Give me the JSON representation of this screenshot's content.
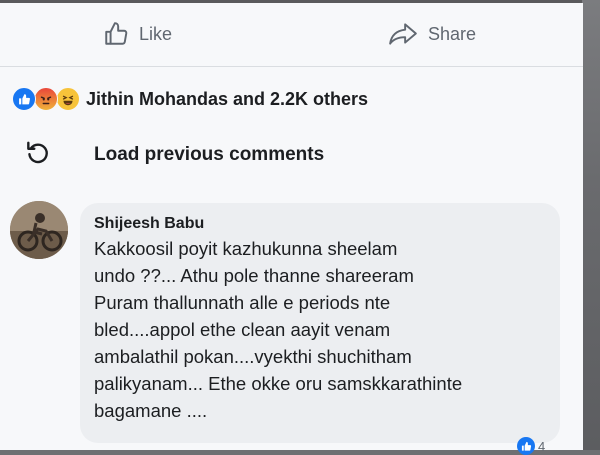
{
  "actions": {
    "like_label": "Like",
    "share_label": "Share"
  },
  "reactions": {
    "icons": [
      "like-icon",
      "angry-icon",
      "haha-icon"
    ],
    "summary": "Jithin Mohandas and 2.2K others"
  },
  "load_previous": {
    "label": "Load previous comments",
    "icon": "refresh-icon"
  },
  "comment": {
    "author": "Shijeesh Babu",
    "lines": [
      "Kakkoosil poyit kazhukunna sheelam",
      "undo ??... Athu pole thanne shareeram",
      "Puram thallunnath alle e periods nte",
      "bled....appol ethe clean aayit venam",
      "ambalathil pokan....vyekthi shuchitham",
      "palikyanam... Ethe okke oru samskkarathinte",
      "bagamane ...."
    ],
    "reaction_count": "4"
  },
  "colors": {
    "facebook_blue": "#1877f2",
    "bubble_bg": "#eceef1",
    "panel_bg": "#f7f8fa"
  }
}
